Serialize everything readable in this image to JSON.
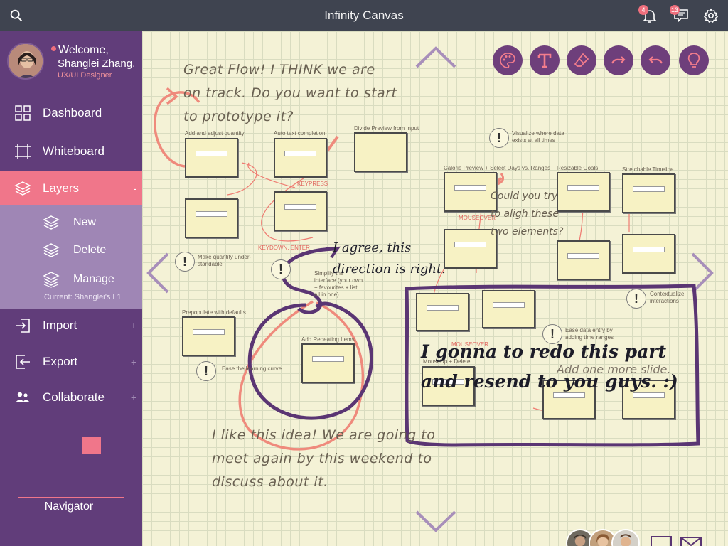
{
  "app": {
    "title": "Infinity Canvas"
  },
  "topbar": {
    "notifications_count": "4",
    "messages_count": "13",
    "icons": [
      "search-icon",
      "bell-icon",
      "chat-icon",
      "gear-icon"
    ]
  },
  "profile": {
    "welcome": "Welcome,",
    "name": "Shanglei Zhang.",
    "role": "UX/UI Designer"
  },
  "nav": [
    {
      "label": "Dashboard",
      "icon": "grid-icon"
    },
    {
      "label": "Whiteboard",
      "icon": "crop-icon"
    },
    {
      "label": "Layers",
      "icon": "layers-icon",
      "toggle": "-"
    },
    {
      "label": "Import",
      "icon": "import-icon",
      "toggle": "+"
    },
    {
      "label": "Export",
      "icon": "export-icon",
      "toggle": "+"
    },
    {
      "label": "Collaborate",
      "icon": "people-icon",
      "toggle": "+"
    }
  ],
  "layers_sub": [
    {
      "label": "New"
    },
    {
      "label": "Delete"
    },
    {
      "label": "Manage"
    }
  ],
  "current_layer": "Current: Shanglei’s L1",
  "navigator": {
    "label": "Navigator"
  },
  "canvas": {
    "notes": {
      "great_flow_1": "Great Flow! I THINK we are",
      "great_flow_2": "on track. Do you want to start",
      "great_flow_3": "to prototype it?",
      "agree_1": "I agree, this",
      "agree_2": "direction is right.",
      "align_1": "Could you try",
      "align_2": "to aligh these",
      "align_3": "two elements?",
      "redo_1": "I gonna to redo this part",
      "redo_2": "and resend to you guys. :)",
      "like_1": "I like this idea! We are going to",
      "like_2": "meet again by this weekend to",
      "like_3": "discuss about it.",
      "add_slide": "Add one more slide."
    },
    "card_labels": {
      "add_adjust": "Add and adjust quantity",
      "auto_text": "Auto text completion",
      "divide_preview": "Divide Preview from Input",
      "calorie_preview": "Calorie Preview + Select Days vs. Ranges",
      "resizable_goals": "Resizable Goals",
      "stretchable_timeline": "Stretchable Timeline",
      "prepopulate": "Prepopulate with defaults",
      "add_repeating": "Add Repeating Items",
      "keypress": "KEYPRESS",
      "keydown": "KEYDOWN, ENTER",
      "mouseover_1": "MOUSEOVER",
      "mouseover_2": "MOUSEOVER",
      "mouseup_delete": "MouseUp + Delete"
    },
    "small_notes": {
      "visualize": "Visualize where data exists at all times",
      "quantity": "Make quantity under-standable",
      "simplify": "Simplify the interface (your own + favourites + list, all in one)",
      "ease_curve": "Ease the learning curve",
      "contextualize": "Contextualize interactions",
      "ease_entry": "Ease data entry by adding time ranges"
    },
    "tools": [
      "palette-icon",
      "text-icon",
      "eraser-icon",
      "redo-icon",
      "undo-icon",
      "lightbulb-icon"
    ]
  },
  "colors": {
    "topbar": "#3f4450",
    "sidebar": "#613d7a",
    "accent": "#f0768a",
    "sub_panel": "#9f86b5",
    "tool_bg": "#6e3f7b"
  }
}
